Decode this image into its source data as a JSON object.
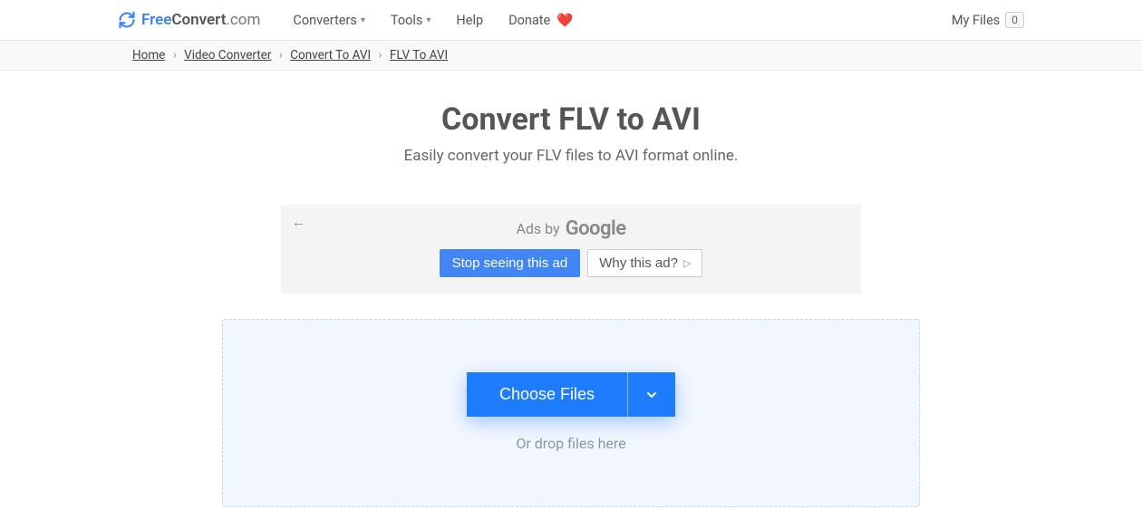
{
  "header": {
    "logo_free": "Free",
    "logo_convert": "Convert",
    "logo_dot": ".com",
    "nav": {
      "converters": "Converters",
      "tools": "Tools",
      "help": "Help",
      "donate": "Donate"
    },
    "myfiles_label": "My Files",
    "myfiles_count": "0"
  },
  "breadcrumb": {
    "home": "Home",
    "video_converter": "Video Converter",
    "convert_to_avi": "Convert To AVI",
    "flv_to_avi": "FLV To AVI"
  },
  "main": {
    "title": "Convert FLV to AVI",
    "subtitle": "Easily convert your FLV files to AVI format online."
  },
  "ad": {
    "ads_by": "Ads by",
    "google": "Google",
    "stop": "Stop seeing this ad",
    "why": "Why this ad?"
  },
  "dropzone": {
    "choose": "Choose Files",
    "drop": "Or drop files here"
  }
}
